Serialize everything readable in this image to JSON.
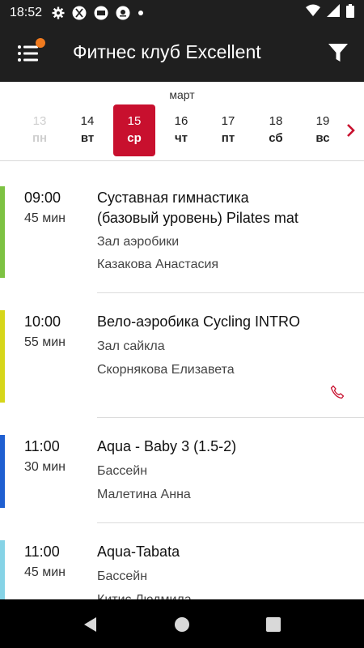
{
  "status_bar": {
    "time": "18:52",
    "icons": [
      "gear-icon",
      "x-app-icon",
      "brand-icon-1",
      "brand-icon-2",
      "dot-icon",
      "wifi-icon",
      "signal-icon",
      "battery-icon"
    ]
  },
  "app_bar": {
    "title": "Фитнес клуб Excellent",
    "menu_icon": "menu-list-icon",
    "filter_icon": "filter-icon",
    "notification_color": "#f07a1e"
  },
  "date_strip": {
    "month": "март",
    "days": [
      {
        "num": "13",
        "weekday": "пн",
        "state": "disabled"
      },
      {
        "num": "14",
        "weekday": "вт",
        "state": "normal"
      },
      {
        "num": "15",
        "weekday": "ср",
        "state": "selected"
      },
      {
        "num": "16",
        "weekday": "чт",
        "state": "normal"
      },
      {
        "num": "17",
        "weekday": "пт",
        "state": "normal"
      },
      {
        "num": "18",
        "weekday": "сб",
        "state": "normal"
      },
      {
        "num": "19",
        "weekday": "вс",
        "state": "normal"
      }
    ],
    "selected_color": "#c8102e"
  },
  "classes": [
    {
      "time": "09:00",
      "duration": "45 мин",
      "title_line1": "Суставная гимнастика",
      "title_line2": "(базовый уровень)  Pilates mat",
      "room": "Зал аэробики",
      "trainer": "Казакова Анастасия",
      "color": "#7dc242",
      "phone": false
    },
    {
      "time": "10:00",
      "duration": "55 мин",
      "title_line1": "Вело-аэробика Cycling INTRO",
      "title_line2": "",
      "room": "Зал сайкла",
      "trainer": "Скорнякова Елизавета",
      "color": "#d6d61a",
      "phone": true
    },
    {
      "time": "11:00",
      "duration": "30 мин",
      "title_line1": "Aqua - Baby 3 (1.5-2)",
      "title_line2": "",
      "room": "Бассейн",
      "trainer": "Малетина Анна",
      "color": "#1f5fd1",
      "phone": false
    },
    {
      "time": "11:00",
      "duration": "45 мин",
      "title_line1": "Aqua-Tabata",
      "title_line2": "",
      "room": "Бассейн",
      "trainer": "Китис Людмила",
      "color": "#86d3e6",
      "phone": false
    }
  ],
  "nav_bar": {
    "back_icon": "back-triangle-icon",
    "home_icon": "home-circle-icon",
    "recents_icon": "recents-square-icon"
  }
}
